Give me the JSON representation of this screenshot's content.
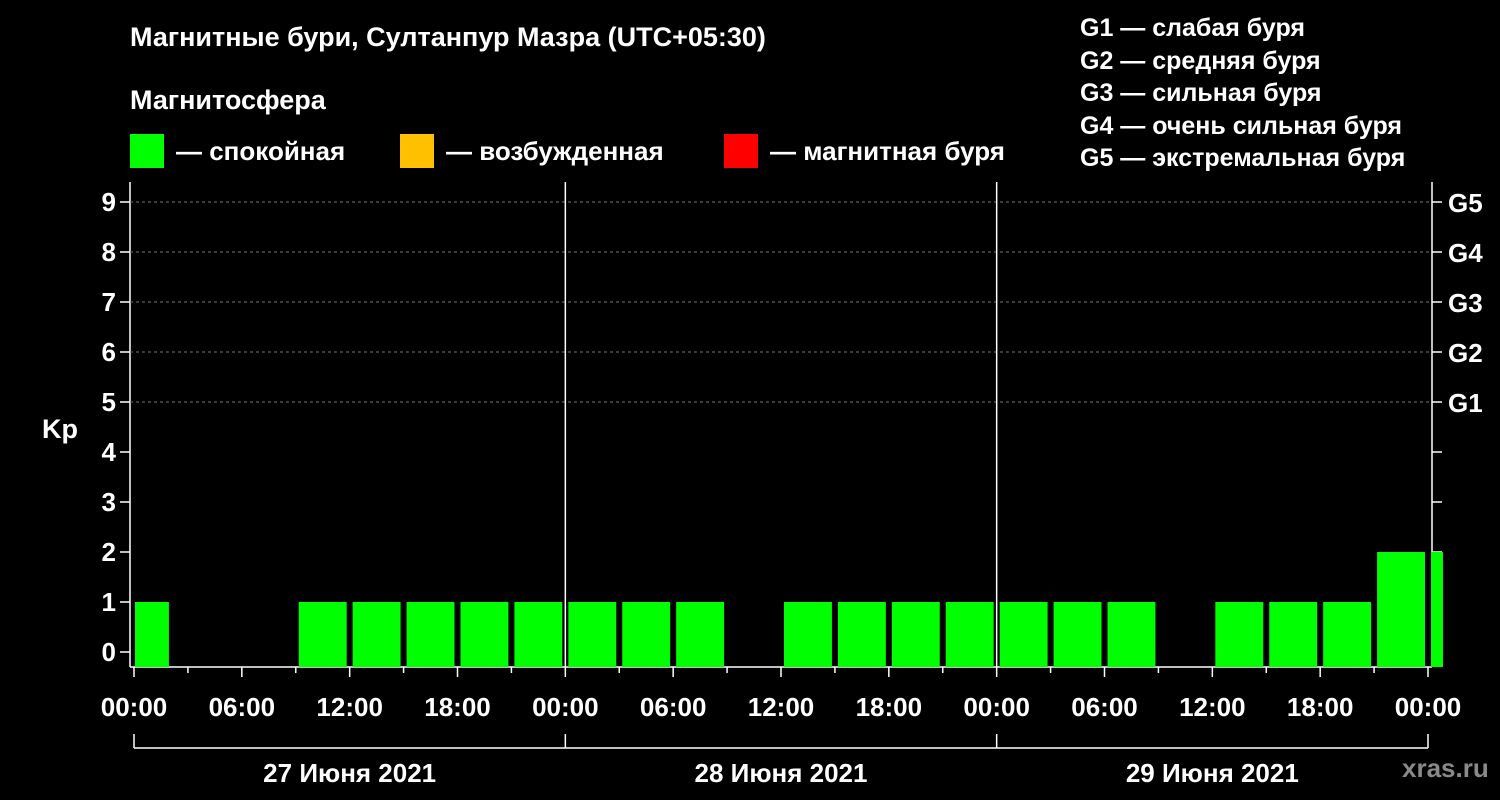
{
  "title": "Магнитные бури, Султанпур Мазра (UTC+05:30)",
  "watermark": "xras.ru",
  "magnetosphere": {
    "heading": "Магнитосфера",
    "items": [
      {
        "label": "— спокойная",
        "color": "#00ff00"
      },
      {
        "label": "— возбужденная",
        "color": "#ffc000"
      },
      {
        "label": "— магнитная буря",
        "color": "#ff0000"
      }
    ]
  },
  "g_scale": [
    "G1 — слабая буря",
    "G2 — средняя буря",
    "G3 — сильная буря",
    "G4 — очень сильная буря",
    "G5 — экстремальная буря"
  ],
  "chart_data": {
    "type": "bar",
    "ylabel": "Kp",
    "ylim": [
      -0.3,
      9.4
    ],
    "y_ticks": [
      "0",
      "1",
      "2",
      "3",
      "4",
      "5",
      "6",
      "7",
      "8",
      "9"
    ],
    "right_ticks": [
      {
        "kp": 5,
        "label": "G1"
      },
      {
        "kp": 6,
        "label": "G2"
      },
      {
        "kp": 7,
        "label": "G3"
      },
      {
        "kp": 8,
        "label": "G4"
      },
      {
        "kp": 9,
        "label": "G5"
      }
    ],
    "grid": "dashed horizontal at Kp 5–9",
    "x_tick_labels": [
      "00:00",
      "06:00",
      "12:00",
      "18:00",
      "00:00",
      "06:00",
      "12:00",
      "18:00",
      "00:00",
      "06:00",
      "12:00",
      "18:00",
      "00:00"
    ],
    "days": [
      "27 Июня 2021",
      "28 Июня 2021",
      "29 Июня 2021"
    ],
    "interval_hours": 3,
    "values": [
      1,
      0,
      0,
      1,
      1,
      1,
      1,
      1,
      1,
      1,
      1,
      0,
      1,
      1,
      1,
      1,
      1,
      1,
      1,
      0,
      1,
      1,
      1,
      2,
      2
    ],
    "partial_last_hours": 1,
    "color": "#00ff00"
  }
}
